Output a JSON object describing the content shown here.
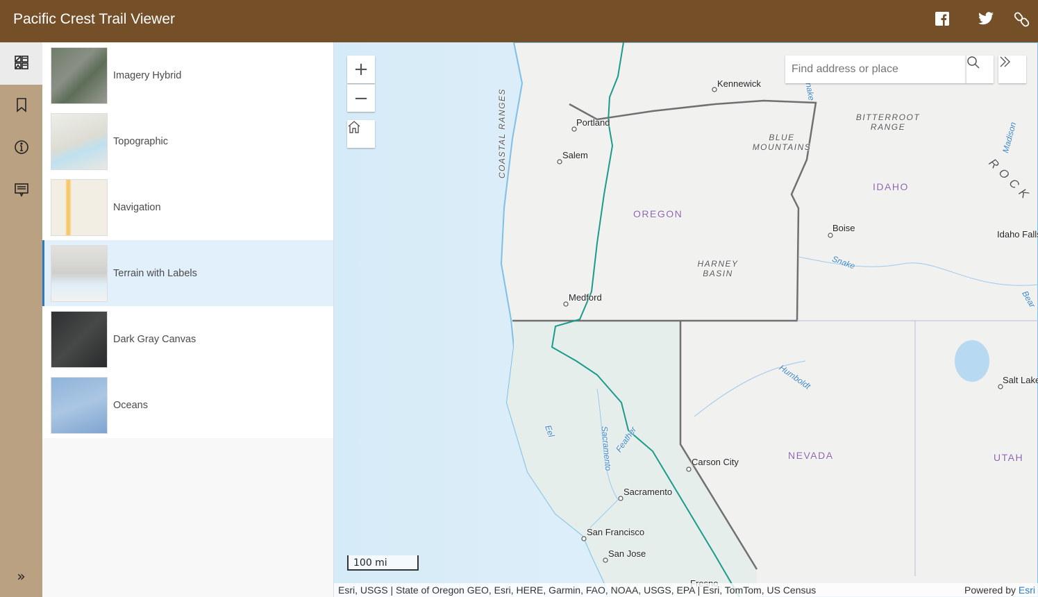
{
  "header": {
    "title": "Pacific Crest Trail Viewer",
    "icons": [
      "facebook-icon",
      "twitter-icon",
      "link-icon"
    ],
    "color": "#744f28"
  },
  "rail": {
    "items": [
      "basemap-gallery-icon",
      "bookmark-icon",
      "info-icon",
      "legend-icon"
    ],
    "expand_label": "»"
  },
  "basemaps": {
    "items": [
      {
        "label": "Imagery Hybrid",
        "selected": false
      },
      {
        "label": "Topographic",
        "selected": false
      },
      {
        "label": "Navigation",
        "selected": false
      },
      {
        "label": "Terrain with Labels",
        "selected": true
      },
      {
        "label": "Dark Gray Canvas",
        "selected": false
      },
      {
        "label": "Oceans",
        "selected": false
      }
    ]
  },
  "map": {
    "zoom_in": "+",
    "zoom_out": "−",
    "search": {
      "placeholder": "Find address or place",
      "value": ""
    },
    "scale": "100 mi",
    "labels": [
      "Kennewick",
      "Portland",
      "Salem",
      "Medford",
      "COASTAL RANGES",
      "BLUE MOUNTAINS",
      "OREGON",
      "HARNEY BASIN",
      "BITTERROOT RANGE",
      "IDAHO",
      "Boise",
      "Idaho Falls",
      "Snake",
      "R O C K",
      "Madison",
      "Bear",
      "Humboldt",
      "Salt Lake",
      "NEVADA",
      "UTAH",
      "Carson City",
      "Sacramento",
      "Feather",
      "Sacramento",
      "Eel",
      "San Francisco",
      "San Jose",
      "Fresno",
      "Snake"
    ],
    "attribution": "Esri, USGS | State of Oregon GEO, Esri, HERE, Garmin, FAO, NOAA, USGS, EPA | Esri, TomTom, US Census",
    "powered_by": "Powered by",
    "powered_link": "Esri",
    "trail_color": "#1a9a8a"
  }
}
